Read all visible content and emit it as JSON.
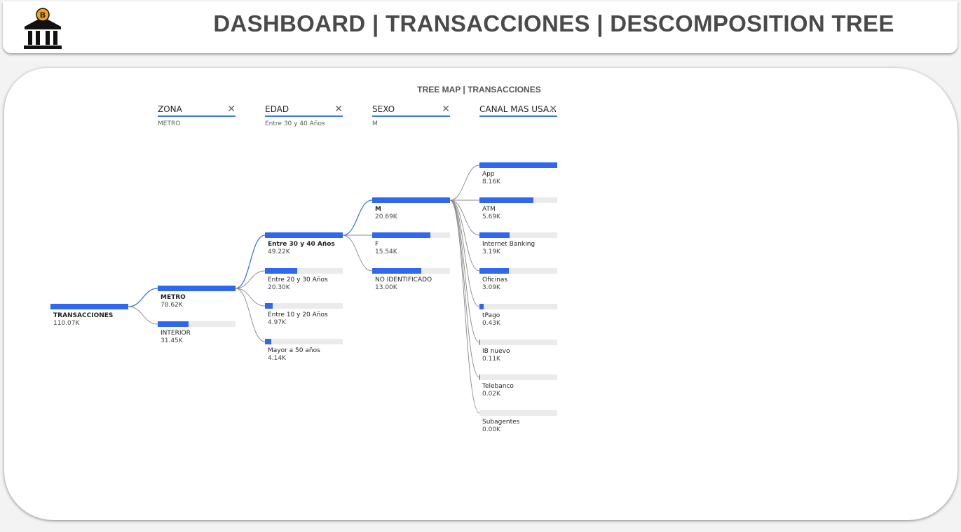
{
  "header": {
    "title": "DASHBOARD | TRANSACCIONES | DESCOMPOSITION TREE",
    "logo_icon": "bank-bitcoin-icon",
    "logo_badge": "B"
  },
  "tree": {
    "title": "TREE MAP | TRANSACCIONES",
    "colors": {
      "fill": "#2f67ee",
      "track": "#ebebeb",
      "active_link": "#3b76e4",
      "link": "#888888"
    },
    "levels": [
      {
        "name": "ZONA",
        "selected": "METRO"
      },
      {
        "name": "EDAD",
        "selected": "Entre 30 y 40 Años"
      },
      {
        "name": "SEXO",
        "selected": "M"
      },
      {
        "name": "CANAL MAS USA...",
        "selected": ""
      }
    ],
    "root": {
      "label": "TRANSACCIONES",
      "value": "110.07K",
      "fraction": 1.0
    },
    "zona": [
      {
        "label": "METRO",
        "value": "78.62K",
        "fraction": 1.0,
        "selected": true
      },
      {
        "label": "INTERIOR",
        "value": "31.45K",
        "fraction": 0.4,
        "selected": false
      }
    ],
    "edad": [
      {
        "label": "Entre 30 y 40 Años",
        "value": "49.22K",
        "fraction": 1.0,
        "selected": true
      },
      {
        "label": "Entre 20 y 30 Años",
        "value": "20.30K",
        "fraction": 0.412,
        "selected": false
      },
      {
        "label": "Entre 10 y 20 Años",
        "value": "4.97K",
        "fraction": 0.101,
        "selected": false
      },
      {
        "label": "Mayor a 50 años",
        "value": "4.14K",
        "fraction": 0.084,
        "selected": false
      }
    ],
    "sexo": [
      {
        "label": "M",
        "value": "20.69K",
        "fraction": 1.0,
        "selected": true
      },
      {
        "label": "F",
        "value": "15.54K",
        "fraction": 0.751,
        "selected": false
      },
      {
        "label": "NO IDENTIFICADO",
        "value": "13.00K",
        "fraction": 0.628,
        "selected": false
      }
    ],
    "canal": [
      {
        "label": "App",
        "value": "8.16K",
        "fraction": 1.0
      },
      {
        "label": "ATM",
        "value": "5.69K",
        "fraction": 0.697
      },
      {
        "label": "Internet Banking",
        "value": "3.19K",
        "fraction": 0.391
      },
      {
        "label": "Oficinas",
        "value": "3.09K",
        "fraction": 0.379
      },
      {
        "label": "tPago",
        "value": "0.43K",
        "fraction": 0.053
      },
      {
        "label": "IB nuevo",
        "value": "0.11K",
        "fraction": 0.013
      },
      {
        "label": "Telebanco",
        "value": "0.02K",
        "fraction": 0.002
      },
      {
        "label": "Subagentes",
        "value": "0.00K",
        "fraction": 0.0
      }
    ]
  }
}
